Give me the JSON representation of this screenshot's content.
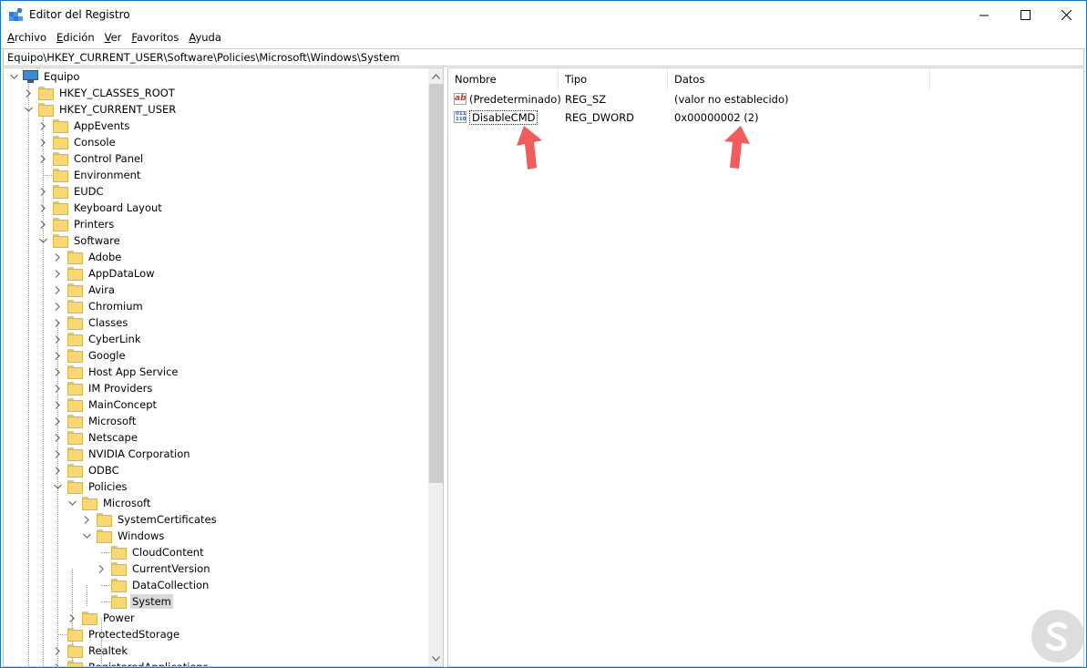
{
  "window": {
    "title": "Editor del Registro",
    "controls": {
      "minimize": "—",
      "maximize": "☐",
      "close": "✕"
    }
  },
  "menu": [
    {
      "label_u": "A",
      "label_rest": "rchivo"
    },
    {
      "label_u": "E",
      "label_rest": "dición"
    },
    {
      "label_u": "V",
      "label_rest": "er"
    },
    {
      "label_u": "F",
      "label_rest": "avoritos"
    },
    {
      "label_u": "A",
      "label_rest": "yuda"
    }
  ],
  "address": "Equipo\\HKEY_CURRENT_USER\\Software\\Policies\\Microsoft\\Windows\\System",
  "tree": {
    "root": "Equipo",
    "items": [
      "HKEY_CLASSES_ROOT",
      "HKEY_CURRENT_USER",
      "AppEvents",
      "Console",
      "Control Panel",
      "Environment",
      "EUDC",
      "Keyboard Layout",
      "Printers",
      "Software",
      "Adobe",
      "AppDataLow",
      "Avira",
      "Chromium",
      "Classes",
      "CyberLink",
      "Google",
      "Host App Service",
      "IM Providers",
      "MainConcept",
      "Microsoft",
      "Netscape",
      "NVIDIA Corporation",
      "ODBC",
      "Policies",
      "Microsoft",
      "SystemCertificates",
      "Windows",
      "CloudContent",
      "CurrentVersion",
      "DataCollection",
      "System",
      "Power",
      "ProtectedStorage",
      "Realtek",
      "RegisteredApplications"
    ]
  },
  "list": {
    "columns": [
      "Nombre",
      "Tipo",
      "Datos"
    ],
    "rows": [
      {
        "name": "(Predeterminado)",
        "type": "REG_SZ",
        "data": "(valor no establecido)",
        "icon": "string-value-icon"
      },
      {
        "name": "DisableCMD",
        "type": "REG_DWORD",
        "data": "0x00000002 (2)",
        "icon": "dword-value-icon"
      }
    ]
  },
  "colors": {
    "accent_border": "#1a74c8",
    "arrow": "#f25c5c",
    "folder": "#f8d775",
    "selection": "#d9d9d9"
  }
}
